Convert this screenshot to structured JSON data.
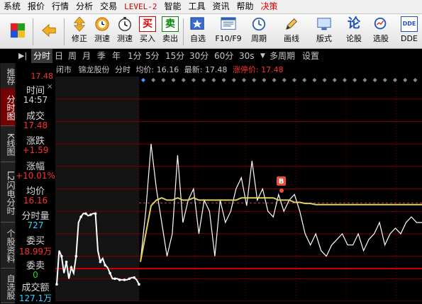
{
  "menu": {
    "items": [
      {
        "label": "系统",
        "key": "system"
      },
      {
        "label": "报价",
        "key": "quote"
      },
      {
        "label": "行情",
        "key": "market"
      },
      {
        "label": "分析",
        "key": "analysis"
      },
      {
        "label": "交易",
        "key": "trade"
      },
      {
        "label": "LEVEL-2",
        "key": "level2"
      },
      {
        "label": "智能",
        "key": "smart"
      },
      {
        "label": "工具",
        "key": "tools"
      },
      {
        "label": "资讯",
        "key": "news"
      },
      {
        "label": "帮助",
        "key": "help"
      },
      {
        "label": "决策",
        "key": "decision"
      }
    ]
  },
  "toolbar": {
    "buttons": [
      {
        "label": "",
        "icon": "color-squares-icon",
        "key": "layout"
      },
      {
        "label": "",
        "icon": "arrow-left-icon",
        "key": "back"
      },
      {
        "label": "修正",
        "icon": "arrow-updown-icon",
        "key": "revise"
      },
      {
        "label": "测速",
        "icon": "clock-icon",
        "key": "speedtest"
      },
      {
        "label": "买入",
        "icon": "buy-icon",
        "key": "buy"
      },
      {
        "label": "卖出",
        "icon": "sell-icon",
        "key": "sell"
      },
      {
        "label": "自选",
        "icon": "star-icon",
        "key": "favorites"
      },
      {
        "label": "F10/F9",
        "icon": "f10-icon",
        "key": "f10"
      },
      {
        "label": "周期",
        "icon": "period-icon",
        "key": "period"
      },
      {
        "label": "画线",
        "icon": "pen-icon",
        "key": "draw"
      },
      {
        "label": "版式",
        "icon": "monitor-icon",
        "key": "layout2"
      },
      {
        "label": "论股",
        "icon": "forum-icon",
        "key": "forum"
      },
      {
        "label": "选股",
        "icon": "stockpick-icon",
        "key": "pick"
      },
      {
        "label": "DDE",
        "icon": "dde-icon",
        "key": "dde"
      }
    ],
    "buy_glyph": "买",
    "sell_glyph": "卖",
    "forum_glyph": "论",
    "dde_text": "DDE",
    "f10_text": "F10"
  },
  "periods": {
    "items": [
      "分时",
      "日",
      "周",
      "月",
      "季",
      "年",
      "1分",
      "5分",
      "15分",
      "30分",
      "60分",
      "30s",
      "多周期",
      "设置"
    ],
    "active": "分时"
  },
  "side_tabs": [
    "推荐",
    "分时图",
    "K线图",
    "L2闪电分时",
    "个股资料",
    "自选股"
  ],
  "info_panel": {
    "top_price": "17.48",
    "rows": [
      {
        "label": "时间",
        "value": "14:57",
        "color": "#d8d8d8"
      },
      {
        "label": "成交",
        "value": "17.48",
        "color": "#ff3030"
      },
      {
        "label": "涨跌",
        "value": "+1.59",
        "color": "#ff3030"
      },
      {
        "label": "涨幅",
        "value": "+10.01%",
        "color": "#ff3030"
      },
      {
        "label": "均价",
        "value": "16.16",
        "color": "#ff3030"
      },
      {
        "label": "分时量",
        "value": "727",
        "color": "#2ad4ff"
      },
      {
        "label": "委买",
        "value": "18.99万",
        "color": "#ff3030"
      },
      {
        "label": "委卖",
        "value": "0",
        "color": "#22dd22"
      },
      {
        "label": "成交额",
        "value": "127.1万",
        "color": "#2ad4ff"
      }
    ]
  },
  "stock_header": {
    "status": "闭市",
    "name": "锦龙股份",
    "mode": "分时",
    "avg_label": "均价:",
    "avg_value": "16.16",
    "last_label": "最新:",
    "last_value": "17.48",
    "limit_label": "涨停价:",
    "limit_value": "17.48"
  },
  "marker": {
    "text": "B",
    "color": "#e8503c"
  },
  "colors": {
    "up": "#ff3030",
    "down": "#22dd22",
    "avg_line": "#e0d060",
    "price_line": "#ffffff",
    "grid_red": "#7a0000",
    "prev_close": "#cc0000"
  },
  "chart_data": {
    "type": "line",
    "ylim": [
      15.6,
      17.6
    ],
    "prev_close": 15.89,
    "series": [
      {
        "key": "price_left",
        "values": [
          15.75,
          16.05,
          16.0,
          15.85,
          15.95,
          15.8,
          15.9,
          15.85,
          16.0,
          16.3,
          16.35,
          16.38,
          16.38,
          16.36,
          16.37,
          16.38,
          16.38,
          16.05,
          15.95,
          15.98,
          15.92,
          15.9,
          15.85,
          15.8,
          15.8,
          15.8,
          15.79,
          15.79,
          15.79,
          15.79,
          15.8,
          15.81,
          15.81,
          15.79,
          15.75
        ]
      },
      {
        "key": "price_right",
        "values": [
          15.95,
          16.4,
          17.0,
          16.6,
          16.3,
          16.0,
          16.2,
          16.9,
          16.3,
          16.5,
          16.6,
          16.2,
          16.5,
          16.4,
          16.0,
          16.5,
          16.3,
          16.4,
          16.6,
          16.7,
          16.45,
          16.85,
          16.5,
          16.6,
          16.4,
          16.35,
          16.55,
          16.4,
          16.5,
          16.55,
          16.4,
          16.2,
          16.1,
          16.2,
          16.05,
          16.0,
          16.1,
          16.15,
          16.2,
          16.1,
          16.1,
          16.2,
          16.05,
          16.15,
          16.2,
          16.3,
          16.1,
          16.2,
          16.25,
          16.2,
          16.3,
          16.35,
          16.3,
          16.3
        ]
      },
      {
        "key": "avg_right",
        "values": [
          15.95,
          16.2,
          16.45,
          16.5,
          16.52,
          16.5,
          16.5,
          16.52,
          16.5,
          16.5,
          16.52,
          16.5,
          16.5,
          16.5,
          16.5,
          16.5,
          16.5,
          16.5,
          16.5,
          16.52,
          16.52,
          16.52,
          16.52,
          16.52,
          16.52,
          16.52,
          16.5,
          16.5,
          16.5,
          16.48,
          16.48,
          16.47,
          16.47,
          16.46,
          16.46,
          16.46,
          16.46,
          16.46,
          16.46,
          16.46,
          16.46,
          16.46,
          16.46,
          16.46,
          16.46,
          16.46,
          16.46,
          16.46,
          16.46,
          16.46,
          16.46,
          16.46,
          16.46,
          16.46
        ]
      }
    ]
  }
}
